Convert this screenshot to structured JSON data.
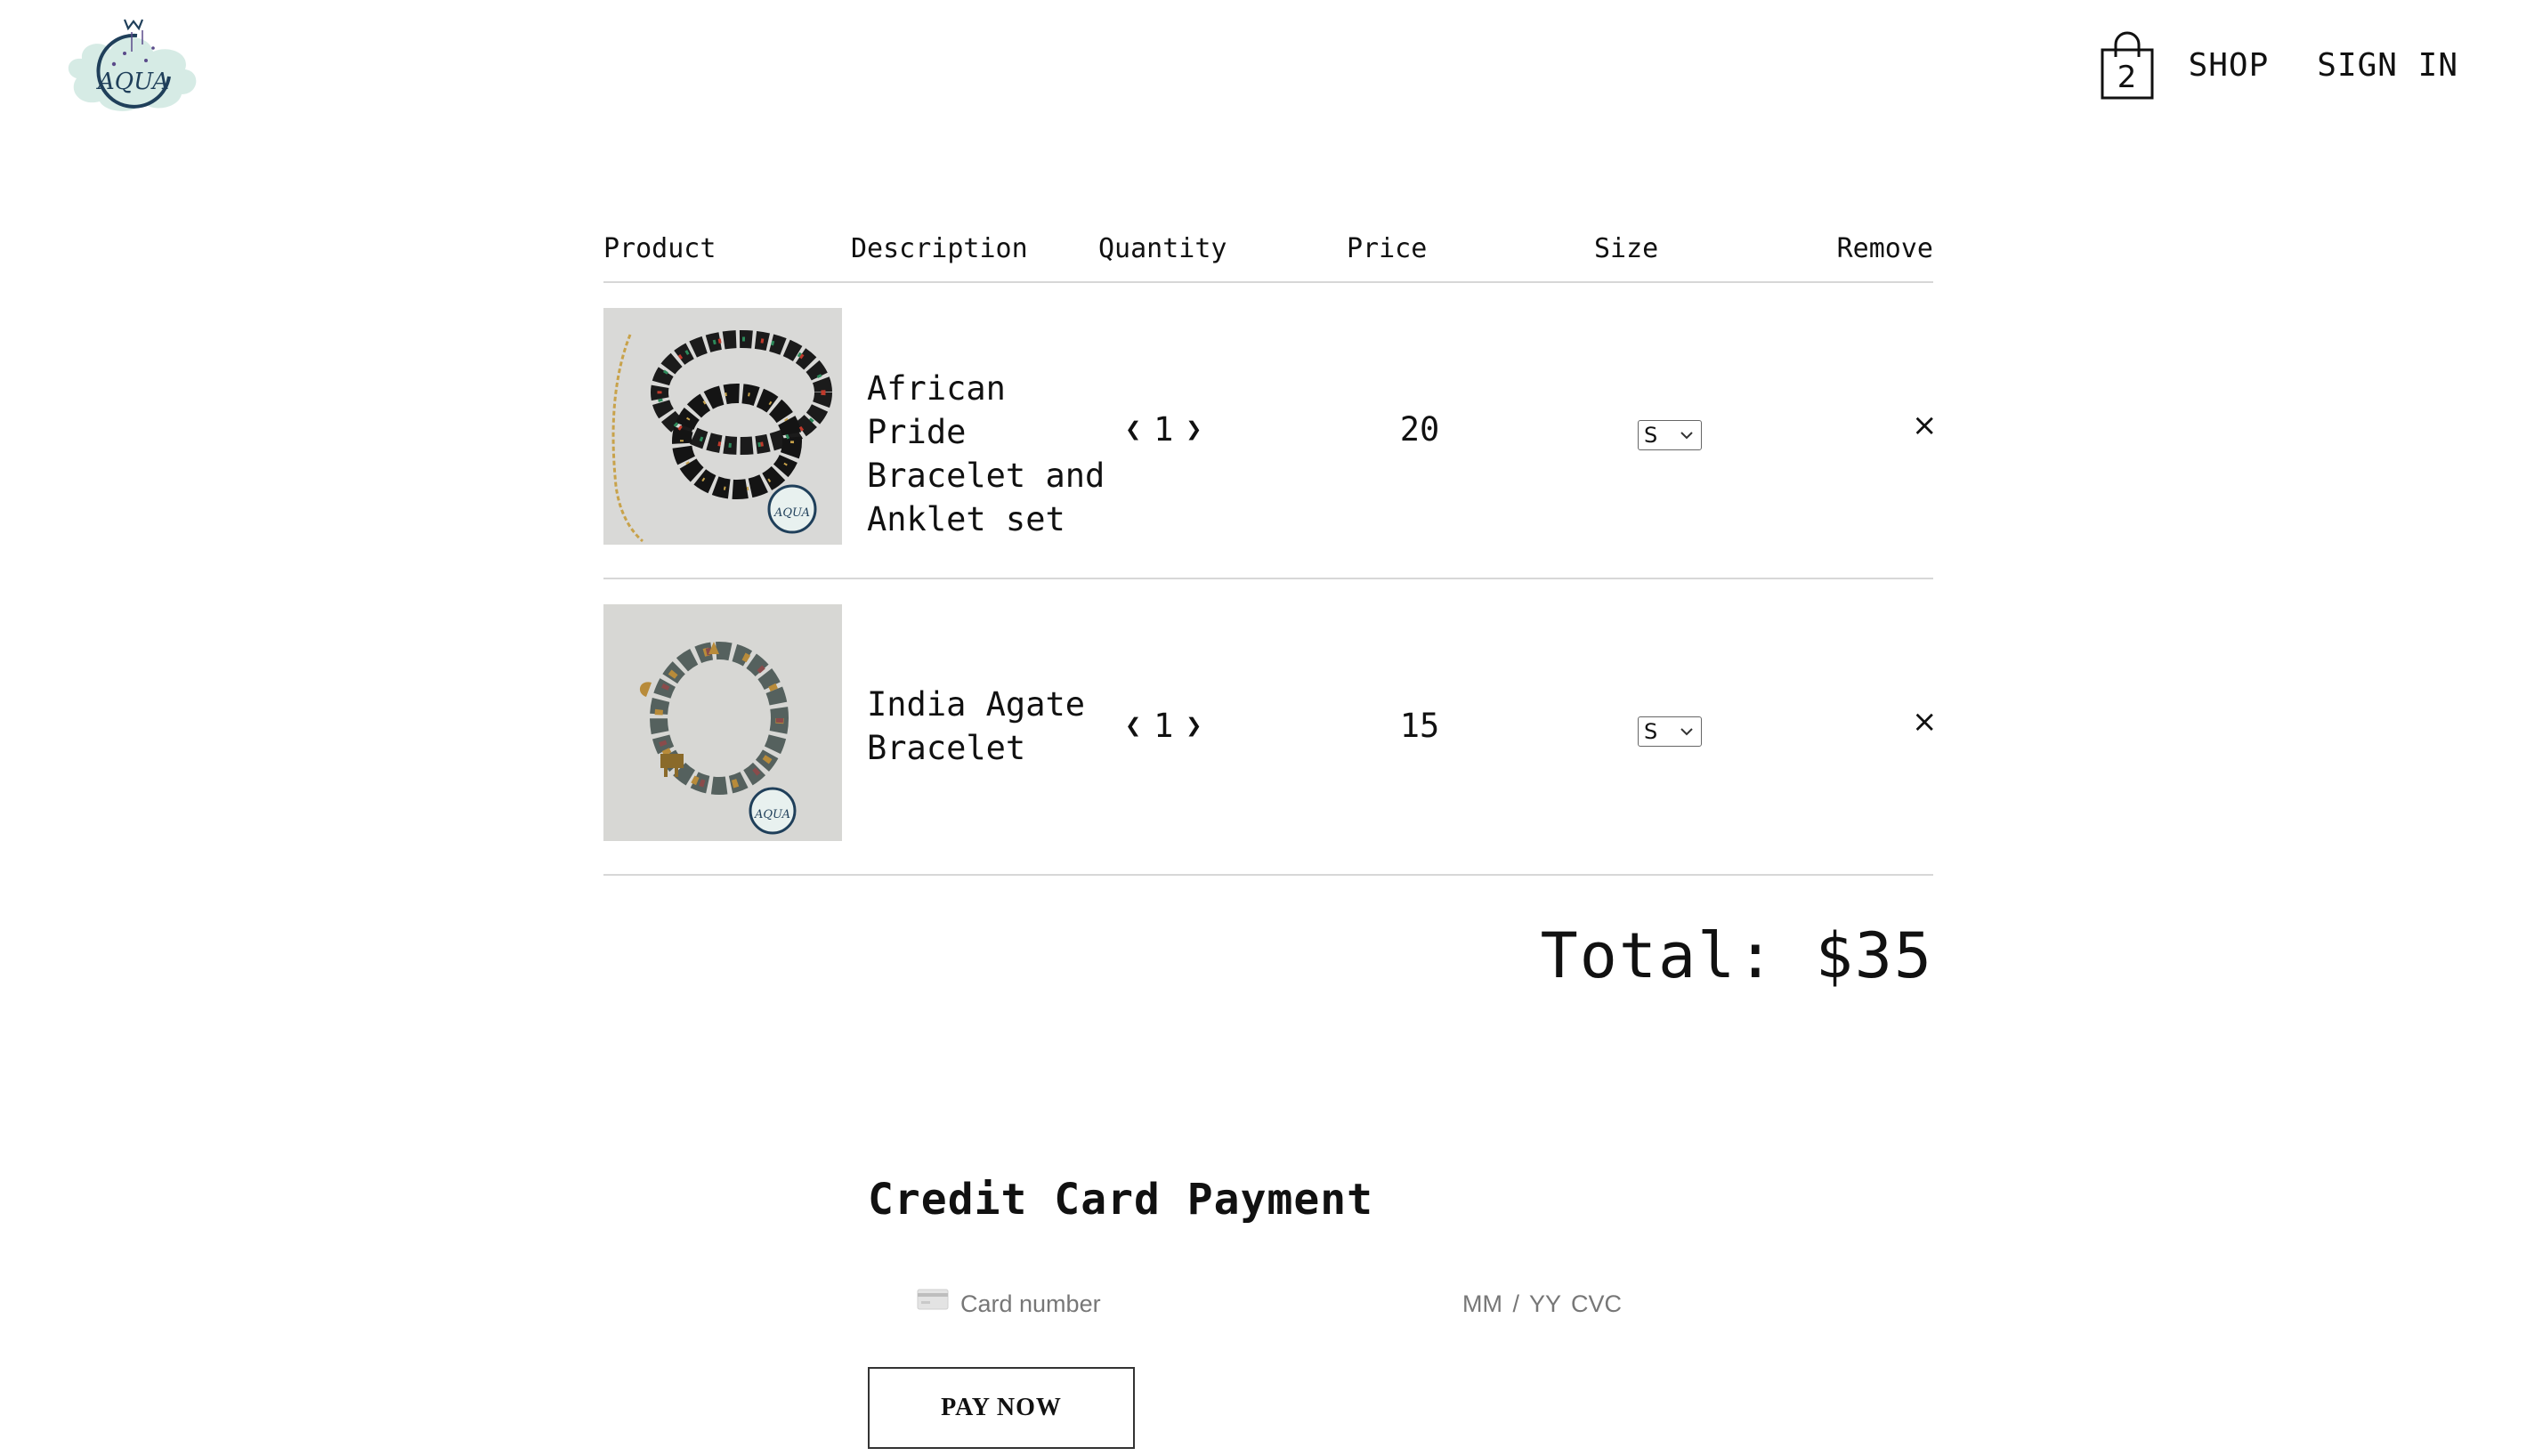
{
  "header": {
    "logo_text": "AQUA",
    "cart_count": "2",
    "nav": [
      {
        "label": "SHOP"
      },
      {
        "label": "SIGN IN"
      }
    ]
  },
  "table": {
    "columns": [
      "Product",
      "Description",
      "Quantity",
      "Price",
      "Size",
      "Remove"
    ]
  },
  "items": [
    {
      "desc_lines": [
        "African Pride",
        "Bracelet and",
        "Anklet set"
      ],
      "quantity": "1",
      "price": "20",
      "size": "S",
      "image_icon": "bracelet-photo-icon"
    },
    {
      "desc_lines": [
        "India Agate",
        "Bracelet"
      ],
      "quantity": "1",
      "price": "15",
      "size": "S",
      "image_icon": "bracelet-photo-icon"
    }
  ],
  "controls": {
    "qty_decrease": "❮",
    "qty_increase": "❯",
    "remove": "×"
  },
  "total": "Total: $35",
  "payment": {
    "title": "Credit Card Payment",
    "card_placeholder": "Card number",
    "expiry_cvc_placeholder": "MM / YY  CVC",
    "button": "PAY NOW"
  },
  "colors": {
    "divider": "#d7d7d7",
    "logo_cloud": "#cfe7e1",
    "logo_ring": "#1f3f5a"
  }
}
